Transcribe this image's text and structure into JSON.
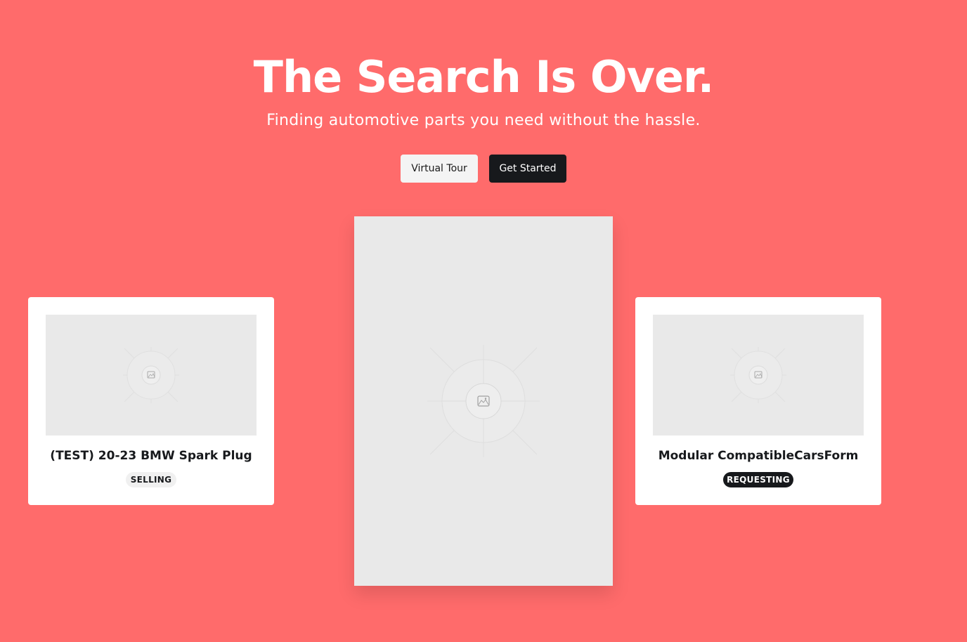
{
  "hero": {
    "title": "The Search Is Over.",
    "subtitle": "Finding automotive parts you need without the hassle."
  },
  "actions": {
    "virtual_tour_label": "Virtual Tour",
    "get_started_label": "Get Started"
  },
  "cards": [
    {
      "title": "(TEST) 20-23 BMW Spark Plug",
      "badge": "SELLING",
      "image_icon": "image-placeholder-icon"
    },
    {
      "title": "Modular CompatibleCarsForm",
      "badge": "REQUESTING",
      "image_icon": "image-placeholder-icon"
    }
  ],
  "featured": {
    "image_icon": "image-placeholder-icon"
  },
  "colors": {
    "background": "#ff6b6b",
    "dark": "#17191c",
    "light_button": "#f4f4f4",
    "placeholder": "#e9e9e9"
  }
}
